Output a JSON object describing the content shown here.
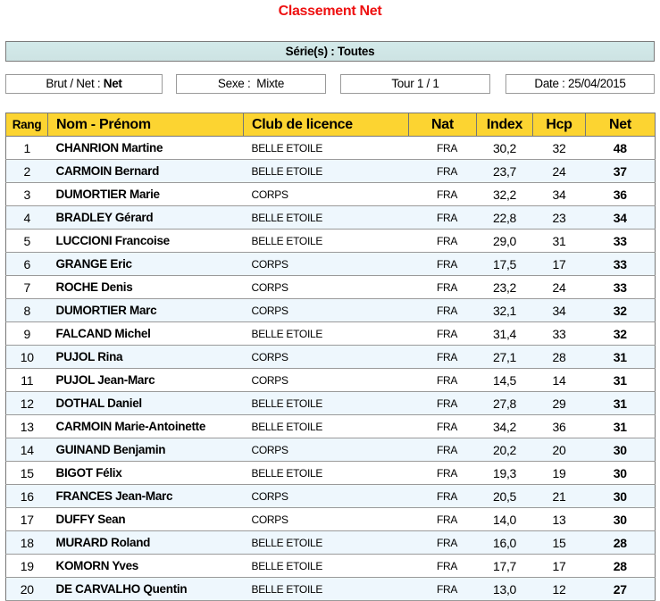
{
  "page": {
    "title": "Classement Net",
    "title_color": "#EE1111",
    "series_label": "Série(s) : Toutes",
    "header_color": "#FCD431",
    "alt_row_color": "#EEF7FD",
    "series_bar_color": "#D3EAEA"
  },
  "filters": {
    "brut_net_label": "Brut / Net : ",
    "brut_net_value": "Net",
    "sexe_label": "Sexe :  ",
    "sexe_value": "Mixte",
    "tour": "Tour 1 / 1",
    "date": "Date : 25/04/2015"
  },
  "table": {
    "columns": [
      "Rang",
      "Nom - Prénom",
      "Club de licence",
      "Nat",
      "Index",
      "Hcp",
      "Net"
    ],
    "rows": [
      {
        "rang": "1",
        "name": "CHANRION Martine",
        "club": "BELLE ETOILE",
        "nat": "FRA",
        "index": "30,2",
        "hcp": "32",
        "net": "48"
      },
      {
        "rang": "2",
        "name": "CARMOIN Bernard",
        "club": "BELLE ETOILE",
        "nat": "FRA",
        "index": "23,7",
        "hcp": "24",
        "net": "37"
      },
      {
        "rang": "3",
        "name": "DUMORTIER Marie",
        "club": "CORPS",
        "nat": "FRA",
        "index": "32,2",
        "hcp": "34",
        "net": "36"
      },
      {
        "rang": "4",
        "name": "BRADLEY Gérard",
        "club": "BELLE ETOILE",
        "nat": "FRA",
        "index": "22,8",
        "hcp": "23",
        "net": "34"
      },
      {
        "rang": "5",
        "name": "LUCCIONI Francoise",
        "club": "BELLE ETOILE",
        "nat": "FRA",
        "index": "29,0",
        "hcp": "31",
        "net": "33"
      },
      {
        "rang": "6",
        "name": "GRANGE Eric",
        "club": "CORPS",
        "nat": "FRA",
        "index": "17,5",
        "hcp": "17",
        "net": "33"
      },
      {
        "rang": "7",
        "name": "ROCHE Denis",
        "club": "CORPS",
        "nat": "FRA",
        "index": "23,2",
        "hcp": "24",
        "net": "33"
      },
      {
        "rang": "8",
        "name": "DUMORTIER Marc",
        "club": "CORPS",
        "nat": "FRA",
        "index": "32,1",
        "hcp": "34",
        "net": "32"
      },
      {
        "rang": "9",
        "name": "FALCAND Michel",
        "club": "BELLE ETOILE",
        "nat": "FRA",
        "index": "31,4",
        "hcp": "33",
        "net": "32"
      },
      {
        "rang": "10",
        "name": "PUJOL Rina",
        "club": "CORPS",
        "nat": "FRA",
        "index": "27,1",
        "hcp": "28",
        "net": "31"
      },
      {
        "rang": "11",
        "name": "PUJOL Jean-Marc",
        "club": "CORPS",
        "nat": "FRA",
        "index": "14,5",
        "hcp": "14",
        "net": "31"
      },
      {
        "rang": "12",
        "name": "DOTHAL Daniel",
        "club": "BELLE ETOILE",
        "nat": "FRA",
        "index": "27,8",
        "hcp": "29",
        "net": "31"
      },
      {
        "rang": "13",
        "name": "CARMOIN Marie-Antoinette",
        "club": "BELLE ETOILE",
        "nat": "FRA",
        "index": "34,2",
        "hcp": "36",
        "net": "31"
      },
      {
        "rang": "14",
        "name": "GUINAND Benjamin",
        "club": "CORPS",
        "nat": "FRA",
        "index": "20,2",
        "hcp": "20",
        "net": "30"
      },
      {
        "rang": "15",
        "name": "BIGOT Félix",
        "club": "BELLE ETOILE",
        "nat": "FRA",
        "index": "19,3",
        "hcp": "19",
        "net": "30"
      },
      {
        "rang": "16",
        "name": "FRANCES Jean-Marc",
        "club": "CORPS",
        "nat": "FRA",
        "index": "20,5",
        "hcp": "21",
        "net": "30"
      },
      {
        "rang": "17",
        "name": "DUFFY Sean",
        "club": "CORPS",
        "nat": "FRA",
        "index": "14,0",
        "hcp": "13",
        "net": "30"
      },
      {
        "rang": "18",
        "name": "MURARD Roland",
        "club": "BELLE ETOILE",
        "nat": "FRA",
        "index": "16,0",
        "hcp": "15",
        "net": "28"
      },
      {
        "rang": "19",
        "name": "KOMORN Yves",
        "club": "BELLE ETOILE",
        "nat": "FRA",
        "index": "17,7",
        "hcp": "17",
        "net": "28"
      },
      {
        "rang": "20",
        "name": "DE CARVALHO Quentin",
        "club": "BELLE ETOILE",
        "nat": "FRA",
        "index": "13,0",
        "hcp": "12",
        "net": "27"
      }
    ]
  }
}
